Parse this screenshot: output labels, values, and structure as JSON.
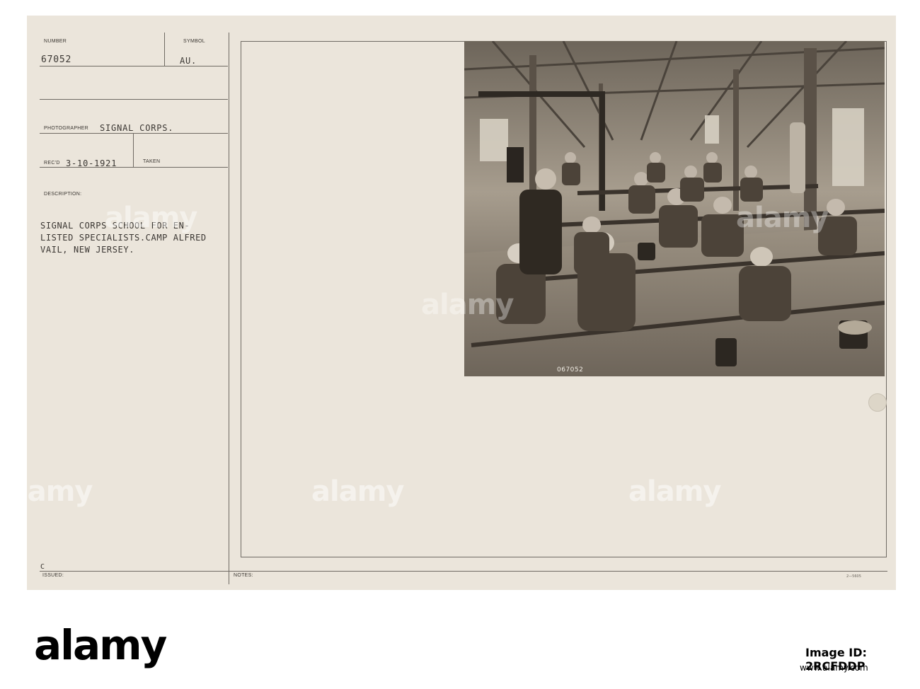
{
  "card": {
    "number_label": "NUMBER",
    "number_value": "67052",
    "symbol_label": "SYMBOL",
    "symbol_value": "AU.",
    "photographer_label": "PHOTOGRAPHER",
    "photographer_value": "SIGNAL CORPS.",
    "recd_label": "REC'D",
    "recd_value": "3-10-1921",
    "taken_label": "TAKEN",
    "description_label": "DESCRIPTION:",
    "description_lines": [
      "SIGNAL CORPS SCHOOL FOR EN-",
      "LISTED SPECIALISTS.CAMP ALFRED",
      "VAIL, NEW JERSEY."
    ],
    "issued_mark": "C",
    "issued_label": "ISSUED:",
    "notes_label": "NOTES:",
    "form_code": "2—5605",
    "photo_negative_number": "067052"
  },
  "watermark": {
    "text": "alamy"
  },
  "footer": {
    "brand": "alamy",
    "image_id": "Image ID: 2RCFDDP",
    "website": "www.alamy.com"
  }
}
